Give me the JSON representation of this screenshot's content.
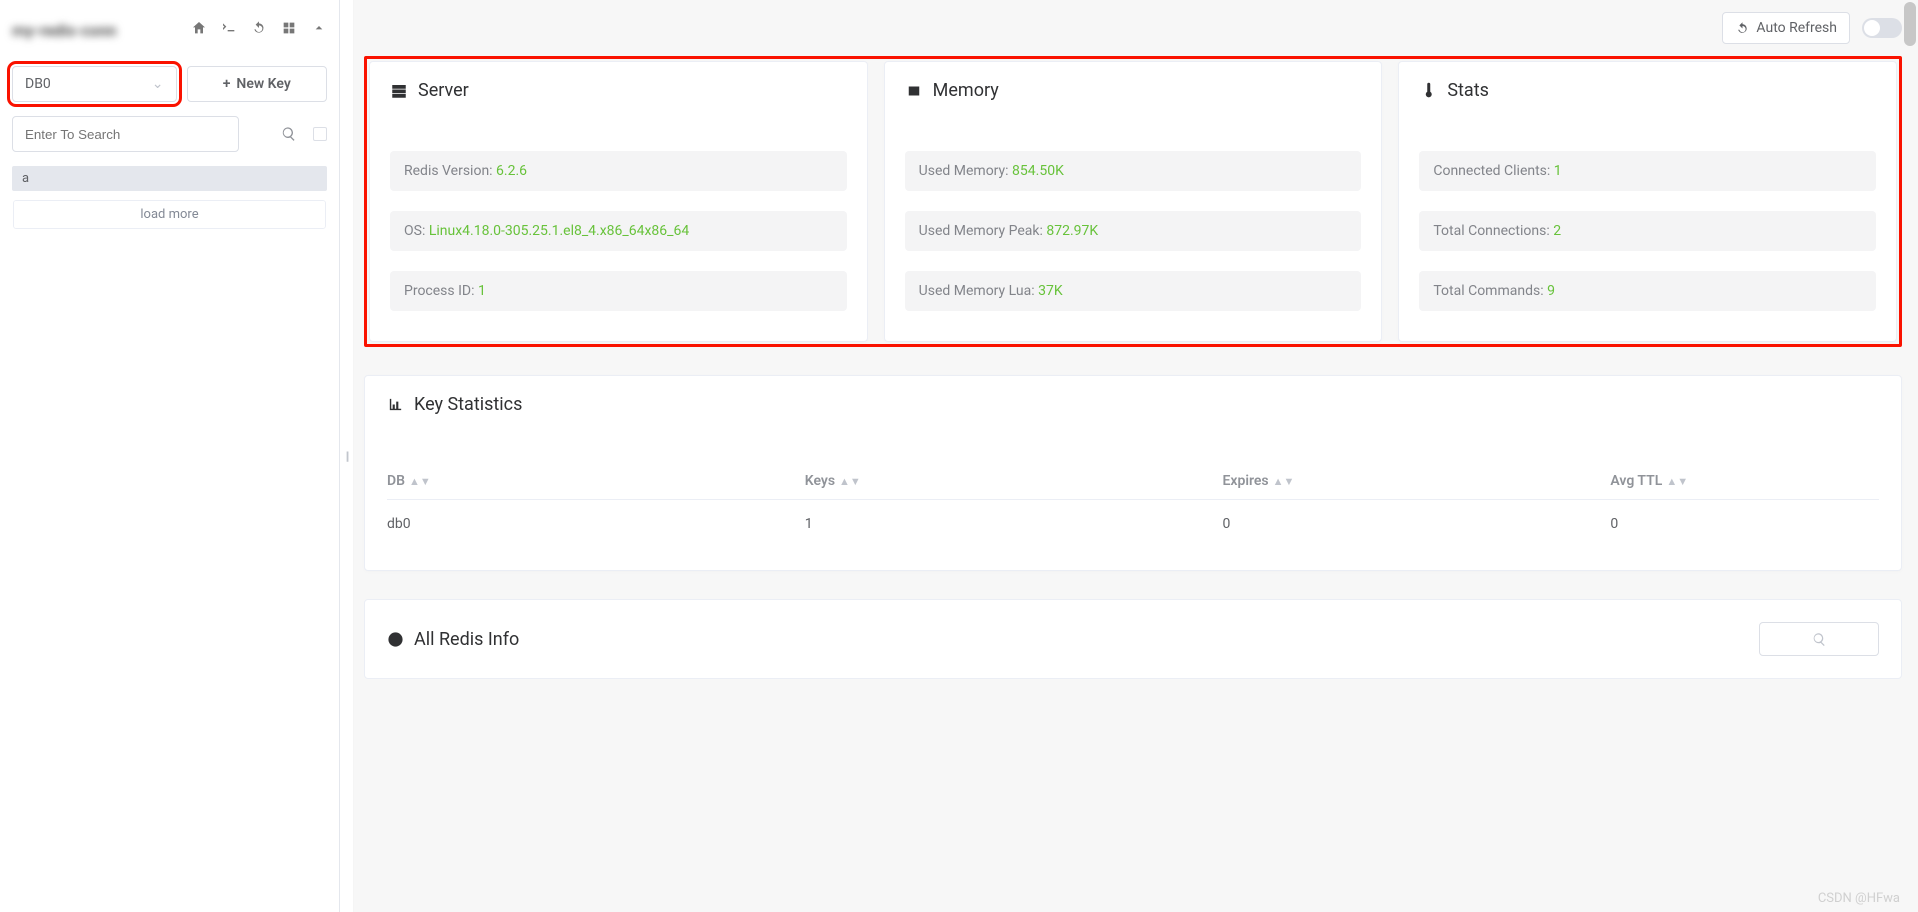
{
  "sidebar": {
    "connection_name": "my-redis-conn",
    "db_select": "DB0",
    "new_key_label": "New Key",
    "search_placeholder": "Enter To Search",
    "key_items": [
      "a"
    ],
    "load_more_label": "load more"
  },
  "topbar": {
    "auto_refresh_label": "Auto Refresh"
  },
  "cards": {
    "server": {
      "title": "Server",
      "rows": [
        {
          "label": "Redis Version: ",
          "value": "6.2.6"
        },
        {
          "label": "OS: ",
          "value": "Linux4.18.0-305.25.1.el8_4.x86_64x86_64"
        },
        {
          "label": "Process ID: ",
          "value": "1"
        }
      ]
    },
    "memory": {
      "title": "Memory",
      "rows": [
        {
          "label": "Used Memory: ",
          "value": "854.50K"
        },
        {
          "label": "Used Memory Peak: ",
          "value": "872.97K"
        },
        {
          "label": "Used Memory Lua: ",
          "value": "37K"
        }
      ]
    },
    "stats": {
      "title": "Stats",
      "rows": [
        {
          "label": "Connected Clients: ",
          "value": "1"
        },
        {
          "label": "Total Connections: ",
          "value": "2"
        },
        {
          "label": "Total Commands: ",
          "value": "9"
        }
      ]
    }
  },
  "key_statistics": {
    "title": "Key Statistics",
    "headers": {
      "db": "DB",
      "keys": "Keys",
      "expires": "Expires",
      "avg_ttl": "Avg TTL"
    },
    "rows": [
      {
        "db": "db0",
        "keys": "1",
        "expires": "0",
        "avg_ttl": "0"
      }
    ]
  },
  "all_info": {
    "title": "All Redis Info"
  },
  "watermark": "CSDN @HFwa"
}
